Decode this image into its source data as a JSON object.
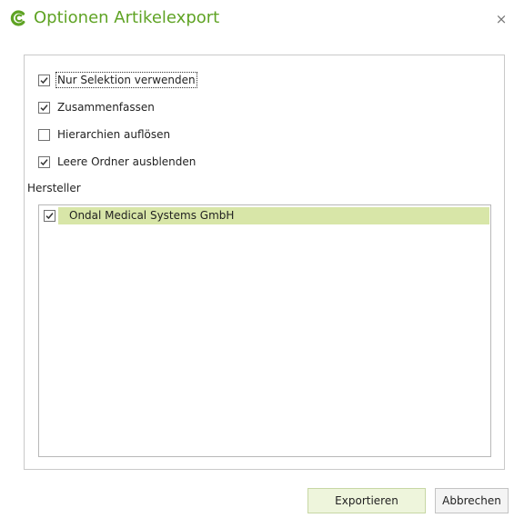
{
  "dialog": {
    "title": "Optionen Artikelexport",
    "close_label": "×",
    "icon": "app-logo-icon",
    "accent_color": "#5fa324"
  },
  "options": [
    {
      "label": "Nur Selektion verwenden",
      "checked": true
    },
    {
      "label": "Zusammenfassen",
      "checked": true
    },
    {
      "label": "Hierarchien auflösen",
      "checked": false
    },
    {
      "label": "Leere Ordner ausblenden",
      "checked": true
    }
  ],
  "manufacturer": {
    "label": "Hersteller",
    "items": [
      {
        "label": "Ondal Medical Systems GmbH",
        "checked": true,
        "highlight_color": "#d8e6a8"
      }
    ]
  },
  "buttons": {
    "export_label": "Exportieren",
    "cancel_label": "Abbrechen"
  }
}
